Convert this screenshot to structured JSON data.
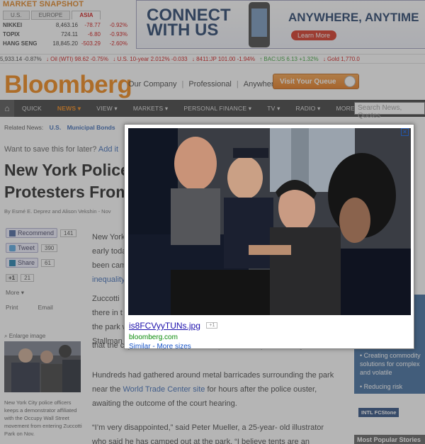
{
  "market": {
    "title": "MARKET SNAPSHOT",
    "tabs": [
      "U.S.",
      "EUROPE",
      "ASIA"
    ],
    "rows": [
      {
        "name": "NIKKEI",
        "value": "8,463.16",
        "change": "-78.77",
        "pct": "-0.92%"
      },
      {
        "name": "TOPIX",
        "value": "724.11",
        "change": "-6.80",
        "pct": "-0.93%"
      },
      {
        "name": "HANG SENG",
        "value": "18,845.20",
        "change": "-503.29",
        "pct": "-2.60%"
      }
    ]
  },
  "ad": {
    "left_text": "CONNECT WITH US",
    "right_text": "ANYWHERE, ANYTIME",
    "button": "Learn More"
  },
  "ticker": [
    {
      "text": "5,933.14 -0.87%",
      "dir": ""
    },
    {
      "text": "↓ Oil (WTI) 98.62 -0.75%",
      "dir": "dn"
    },
    {
      "text": "↓ U.S. 10-year 2.012% -0.033",
      "dir": "dn"
    },
    {
      "text": "↓ 8411:JP 101.00 -1.94%",
      "dir": "dn"
    },
    {
      "text": "↑ BAC:US 6.13 +1.32%",
      "dir": "up"
    },
    {
      "text": "↓ Gold 1,770.0",
      "dir": "dn"
    }
  ],
  "header": {
    "logo": "Bloomberg",
    "links": [
      "Our Company",
      "Professional",
      "Anywhere"
    ],
    "queue_button": "Visit Your Queue"
  },
  "nav": {
    "items": [
      "QUICK",
      "NEWS ▾",
      "VIEW ▾",
      "MARKETS ▾",
      "PERSONAL FINANCE ▾",
      "TV ▾",
      "RADIO ▾",
      "MORE ▾"
    ],
    "search_placeholder": "Search News, Quotes"
  },
  "related": {
    "label": "Related News:",
    "links": [
      "U.S.",
      "Municipal Bonds"
    ]
  },
  "article": {
    "save_prompt": "Want to save this for later?",
    "save_link": "Add it",
    "headline_line1": "New York Police",
    "headline_line2": "Protesters From",
    "byline": "By Esmé E. Deprez and Alison Vekshin - Nov",
    "share": {
      "recommend": "Recommend",
      "recommend_count": "141",
      "tweet": "Tweet",
      "tweet_count": "390",
      "linkedin": "Share",
      "linkedin_count": "61",
      "plus1": "+1",
      "plus1_count": "21",
      "more": "More ▾",
      "print": "Print",
      "email": "Email"
    },
    "enlarge": "Enlarge image",
    "caption": "New York City police officers keeps a demonstrator affiliated with the Occupy Wall Street movement from entering Zuccotti Park on Nov.",
    "para1_a": "New York",
    "para1_b": "early toda",
    "para1_c": "been cam",
    "para1_link": "inequality",
    "para2_a": "Zuccotti",
    "para2_b": "there in t",
    "para2_c": "the park w",
    "para2_d": "Stallman",
    "para2_e": "that the city had the power to rid the plaza of the protesters' gear.",
    "para3_a": "Hundreds had gathered around metal barricades surrounding the park near the",
    "para3_link": "World Trade Center site",
    "para3_b": "for hours after the police ouster, awaiting the outcome of the court hearing.",
    "para4": "“I’m very disappointed,” said Peter Mueller, a 25-year- old illustrator who said he has camped out at the park. “I believe tents are an"
  },
  "sidebar": {
    "box_items": [
      "• Creating commodity solutions for complex and volatile",
      "• Reducing risk"
    ],
    "intl_badge": "INTL FCStone",
    "most_popular": "Most Popular Stories"
  },
  "lightbox": {
    "filename": "is8FCVyyTUNs.jpg",
    "badge": "+1",
    "domain": "bloomberg.com",
    "links": "Similar - More sizes",
    "close": "×"
  }
}
